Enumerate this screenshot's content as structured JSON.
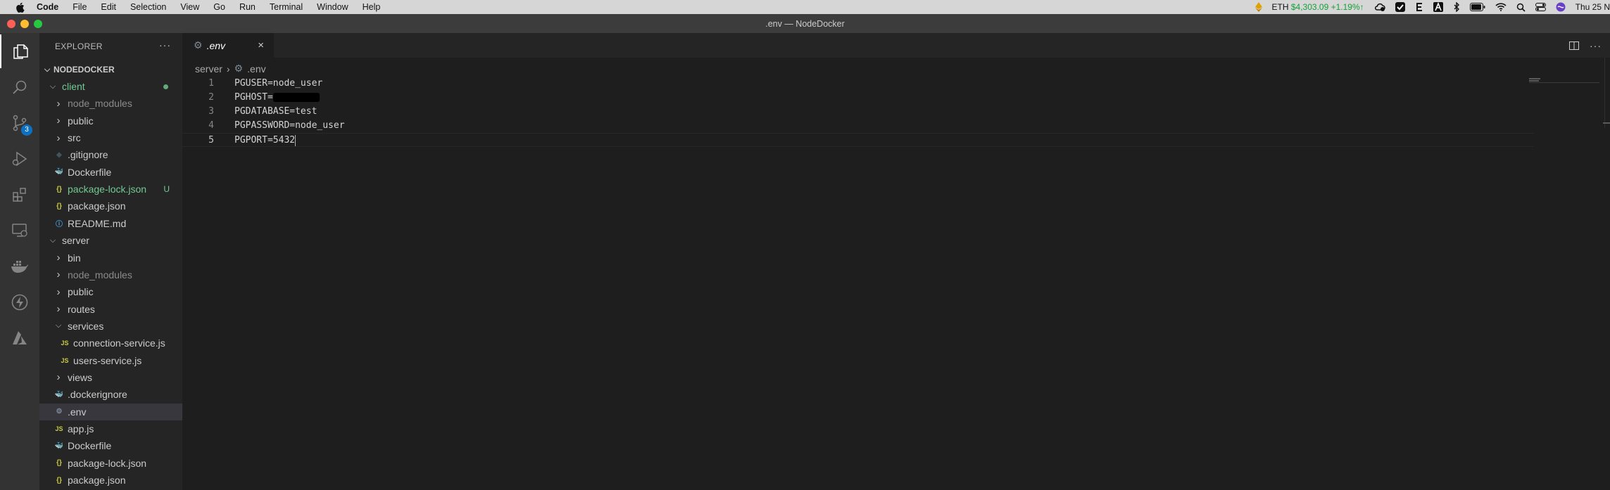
{
  "menubar": {
    "items": [
      "Code",
      "File",
      "Edit",
      "Selection",
      "View",
      "Go",
      "Run",
      "Terminal",
      "Window",
      "Help"
    ],
    "eth_label": "ETH",
    "eth_price": "$4,303.09 +1.19%↑",
    "clock": "Thu 25 N",
    "colors": {
      "eth": "#15a03a"
    }
  },
  "window": {
    "title": ".env — NodeDocker"
  },
  "activitybar": {
    "scm_badge": "3"
  },
  "sidebar": {
    "header": "EXPLORER",
    "more": "···",
    "project": "NODEDOCKER",
    "tree": [
      {
        "label": "client",
        "type": "folder-open",
        "level": 1,
        "status": "modified-dot"
      },
      {
        "label": "node_modules",
        "type": "folder",
        "level": 2,
        "dim": true
      },
      {
        "label": "public",
        "type": "folder",
        "level": 2
      },
      {
        "label": "src",
        "type": "folder",
        "level": 2
      },
      {
        "label": ".gitignore",
        "type": "file",
        "icon": "git",
        "level": 2
      },
      {
        "label": "Dockerfile",
        "type": "file",
        "icon": "docker",
        "level": 2
      },
      {
        "label": "package-lock.json",
        "type": "file",
        "icon": "json",
        "level": 2,
        "status": "U"
      },
      {
        "label": "package.json",
        "type": "file",
        "icon": "json",
        "level": 2
      },
      {
        "label": "README.md",
        "type": "file",
        "icon": "info",
        "level": 2
      },
      {
        "label": "server",
        "type": "folder-open",
        "level": 1
      },
      {
        "label": "bin",
        "type": "folder",
        "level": 2
      },
      {
        "label": "node_modules",
        "type": "folder",
        "level": 2,
        "dim": true
      },
      {
        "label": "public",
        "type": "folder",
        "level": 2
      },
      {
        "label": "routes",
        "type": "folder",
        "level": 2
      },
      {
        "label": "services",
        "type": "folder-open",
        "level": 2
      },
      {
        "label": "connection-service.js",
        "type": "file",
        "icon": "js",
        "level": 3
      },
      {
        "label": "users-service.js",
        "type": "file",
        "icon": "js",
        "level": 3
      },
      {
        "label": "views",
        "type": "folder",
        "level": 2
      },
      {
        "label": ".dockerignore",
        "type": "file",
        "icon": "docker-gray",
        "level": 2
      },
      {
        "label": ".env",
        "type": "file",
        "icon": "gear",
        "level": 2,
        "selected": true
      },
      {
        "label": "app.js",
        "type": "file",
        "icon": "js",
        "level": 2
      },
      {
        "label": "Dockerfile",
        "type": "file",
        "icon": "docker",
        "level": 2
      },
      {
        "label": "package-lock.json",
        "type": "file",
        "icon": "json",
        "level": 2
      },
      {
        "label": "package.json",
        "type": "file",
        "icon": "json",
        "level": 2
      }
    ]
  },
  "editor": {
    "tab": {
      "label": ".env",
      "close": "×"
    },
    "breadcrumb": {
      "folder": "server",
      "separator": "›",
      "file": ".env"
    },
    "lines": [
      {
        "num": "1",
        "text": "PGUSER=node_user"
      },
      {
        "num": "2",
        "text": "PGHOST=",
        "redacted": true
      },
      {
        "num": "3",
        "text": "PGDATABASE=test"
      },
      {
        "num": "4",
        "text": "PGPASSWORD=node_user"
      },
      {
        "num": "5",
        "text": "PGPORT=5432",
        "current": true
      }
    ]
  }
}
